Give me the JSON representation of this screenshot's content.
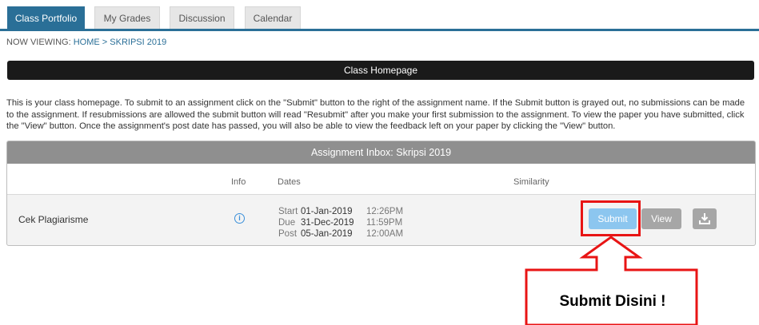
{
  "tabs": [
    {
      "label": "Class Portfolio",
      "active": true
    },
    {
      "label": "My Grades",
      "active": false
    },
    {
      "label": "Discussion",
      "active": false
    },
    {
      "label": "Calendar",
      "active": false
    }
  ],
  "breadcrumb": {
    "prefix": "NOW VIEWING:",
    "home": "HOME",
    "sep": ">",
    "current": "SKRIPSI 2019"
  },
  "home_bar": {
    "title": "Class Homepage"
  },
  "description": "This is your class homepage. To submit to an assignment click on the \"Submit\" button to the right of the assignment name. If the Submit button is grayed out, no submissions can be made to the assignment. If resubmissions are allowed the submit button will read \"Resubmit\" after you make your first submission to the assignment. To view the paper you have submitted, click the \"View\" button. Once the assignment's post date has passed, you will also be able to view the feedback left on your paper by clicking the \"View\" button.",
  "inbox": {
    "title": "Assignment Inbox: Skripsi 2019",
    "headers": {
      "info": "Info",
      "dates": "Dates",
      "similarity": "Similarity"
    },
    "rows": [
      {
        "name": "Cek Plagiarisme",
        "info_icon": "info-icon",
        "dates": [
          {
            "label": "Start",
            "date": "01-Jan-2019",
            "time": "12:26PM"
          },
          {
            "label": "Due",
            "date": "31-Dec-2019",
            "time": "11:59PM"
          },
          {
            "label": "Post",
            "date": "05-Jan-2019",
            "time": "12:00AM"
          }
        ],
        "actions": {
          "submit": "Submit",
          "view": "View",
          "download_icon": "download-icon"
        }
      }
    ]
  },
  "annotation": {
    "text": "Submit Disini !"
  },
  "colors": {
    "tab_active": "#2a6f97",
    "submit_button": "#8cc6ef",
    "annotation": "#e81414"
  }
}
